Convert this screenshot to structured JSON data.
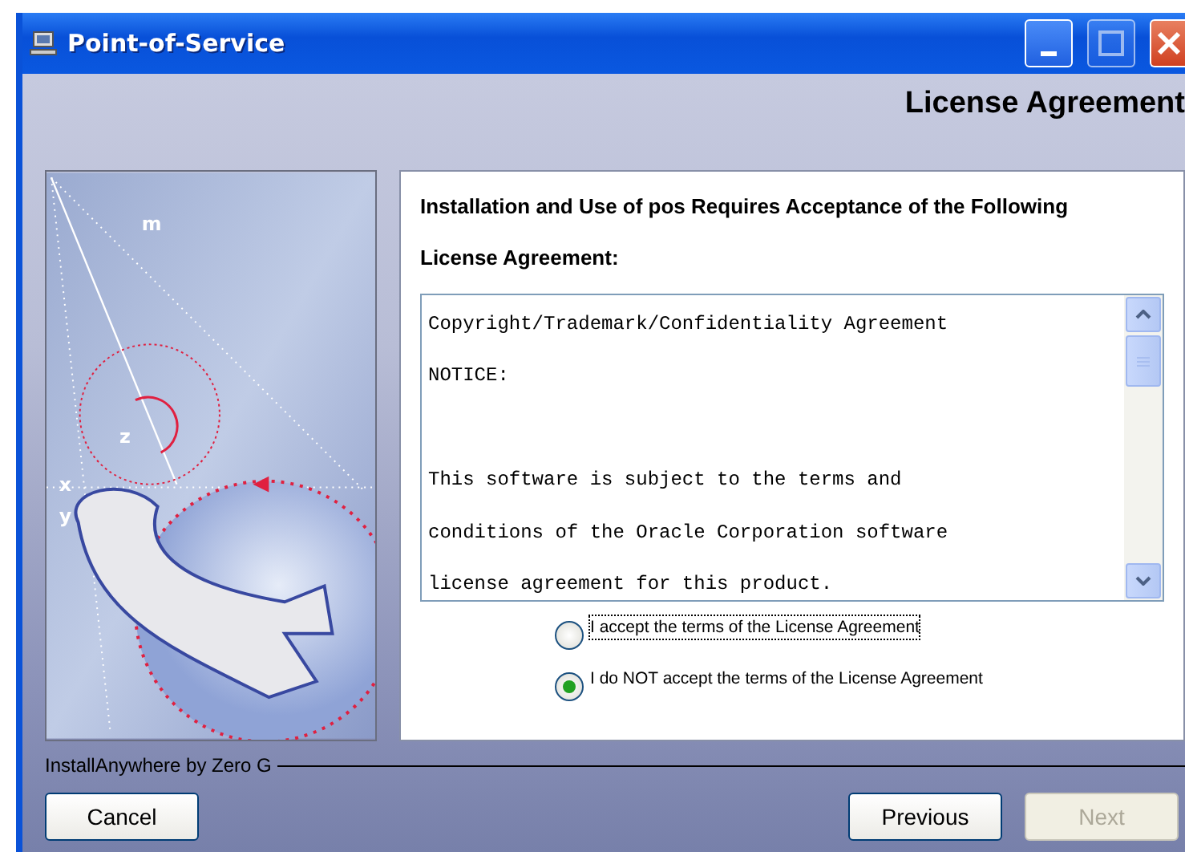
{
  "window": {
    "title": "Point-of-Service"
  },
  "step_title": "License Agreement",
  "illustration": {
    "axis_labels": [
      "m",
      "z",
      "x",
      "y"
    ]
  },
  "panel": {
    "heading": "Installation and Use of pos Requires Acceptance of the Following License Agreement:",
    "license_lines": [
      {
        "text": "Copyright/Trademark/Confidentiality Agreement",
        "kind": "line"
      },
      {
        "text": "NOTICE:",
        "kind": "line"
      },
      {
        "text": "This software is subject to the terms and",
        "kind": "paragraph"
      },
      {
        "text": "conditions of the Oracle Corporation software",
        "kind": "line"
      },
      {
        "text": "license agreement for this product.",
        "kind": "line"
      }
    ],
    "options": [
      {
        "label": "I accept the terms of the License Agreement",
        "selected": false,
        "focused": true
      },
      {
        "label": "I do NOT accept the terms of the License Agreement",
        "selected": true,
        "focused": false
      }
    ]
  },
  "vendor": "InstallAnywhere by Zero G",
  "buttons": [
    {
      "label": "Cancel",
      "disabled": false,
      "kind": "left"
    },
    {
      "label": "Previous",
      "disabled": false,
      "kind": "right"
    },
    {
      "label": "Next",
      "disabled": true,
      "kind": "right"
    }
  ]
}
